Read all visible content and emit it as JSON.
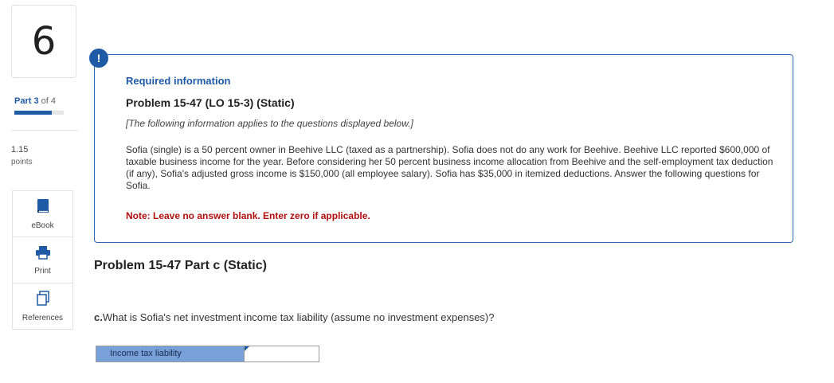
{
  "sidebar": {
    "question_number": "6",
    "part_label": "Part 3",
    "part_of": "of 4",
    "part_progress": 0.75,
    "points_value": "1.15",
    "points_label": "points",
    "tools": [
      {
        "label": "eBook",
        "icon": "book-icon"
      },
      {
        "label": "Print",
        "icon": "printer-icon"
      },
      {
        "label": "References",
        "icon": "references-icon"
      }
    ]
  },
  "info": {
    "alert_symbol": "!",
    "heading": "Required information",
    "problem_title": "Problem 15-47 (LO 15-3) (Static)",
    "italic_note": "[The following information applies to the questions displayed below.]",
    "body": "Sofia (single) is a 50 percent owner in Beehive LLC (taxed as a partnership). Sofia does not do any work for Beehive. Beehive LLC reported $600,000 of taxable business income for the year. Before considering her 50 percent business income allocation from Beehive and the self-employment tax deduction (if any), Sofia's adjusted gross income is $150,000 (all employee salary). Sofia has $35,000 in itemized deductions. Answer the following questions for Sofia.",
    "note": "Note: Leave no answer blank. Enter zero if applicable."
  },
  "part": {
    "heading": "Problem 15-47 Part c (Static)",
    "question_prefix": "c.",
    "question_text": "What is Sofia's net investment income tax liability (assume no investment expenses)?",
    "answer_label": "Income tax liability",
    "answer_value": ""
  },
  "colors": {
    "accent": "#1f5aa6",
    "note_red": "#b20f0f",
    "answer_label_bg": "#78a1d9"
  }
}
